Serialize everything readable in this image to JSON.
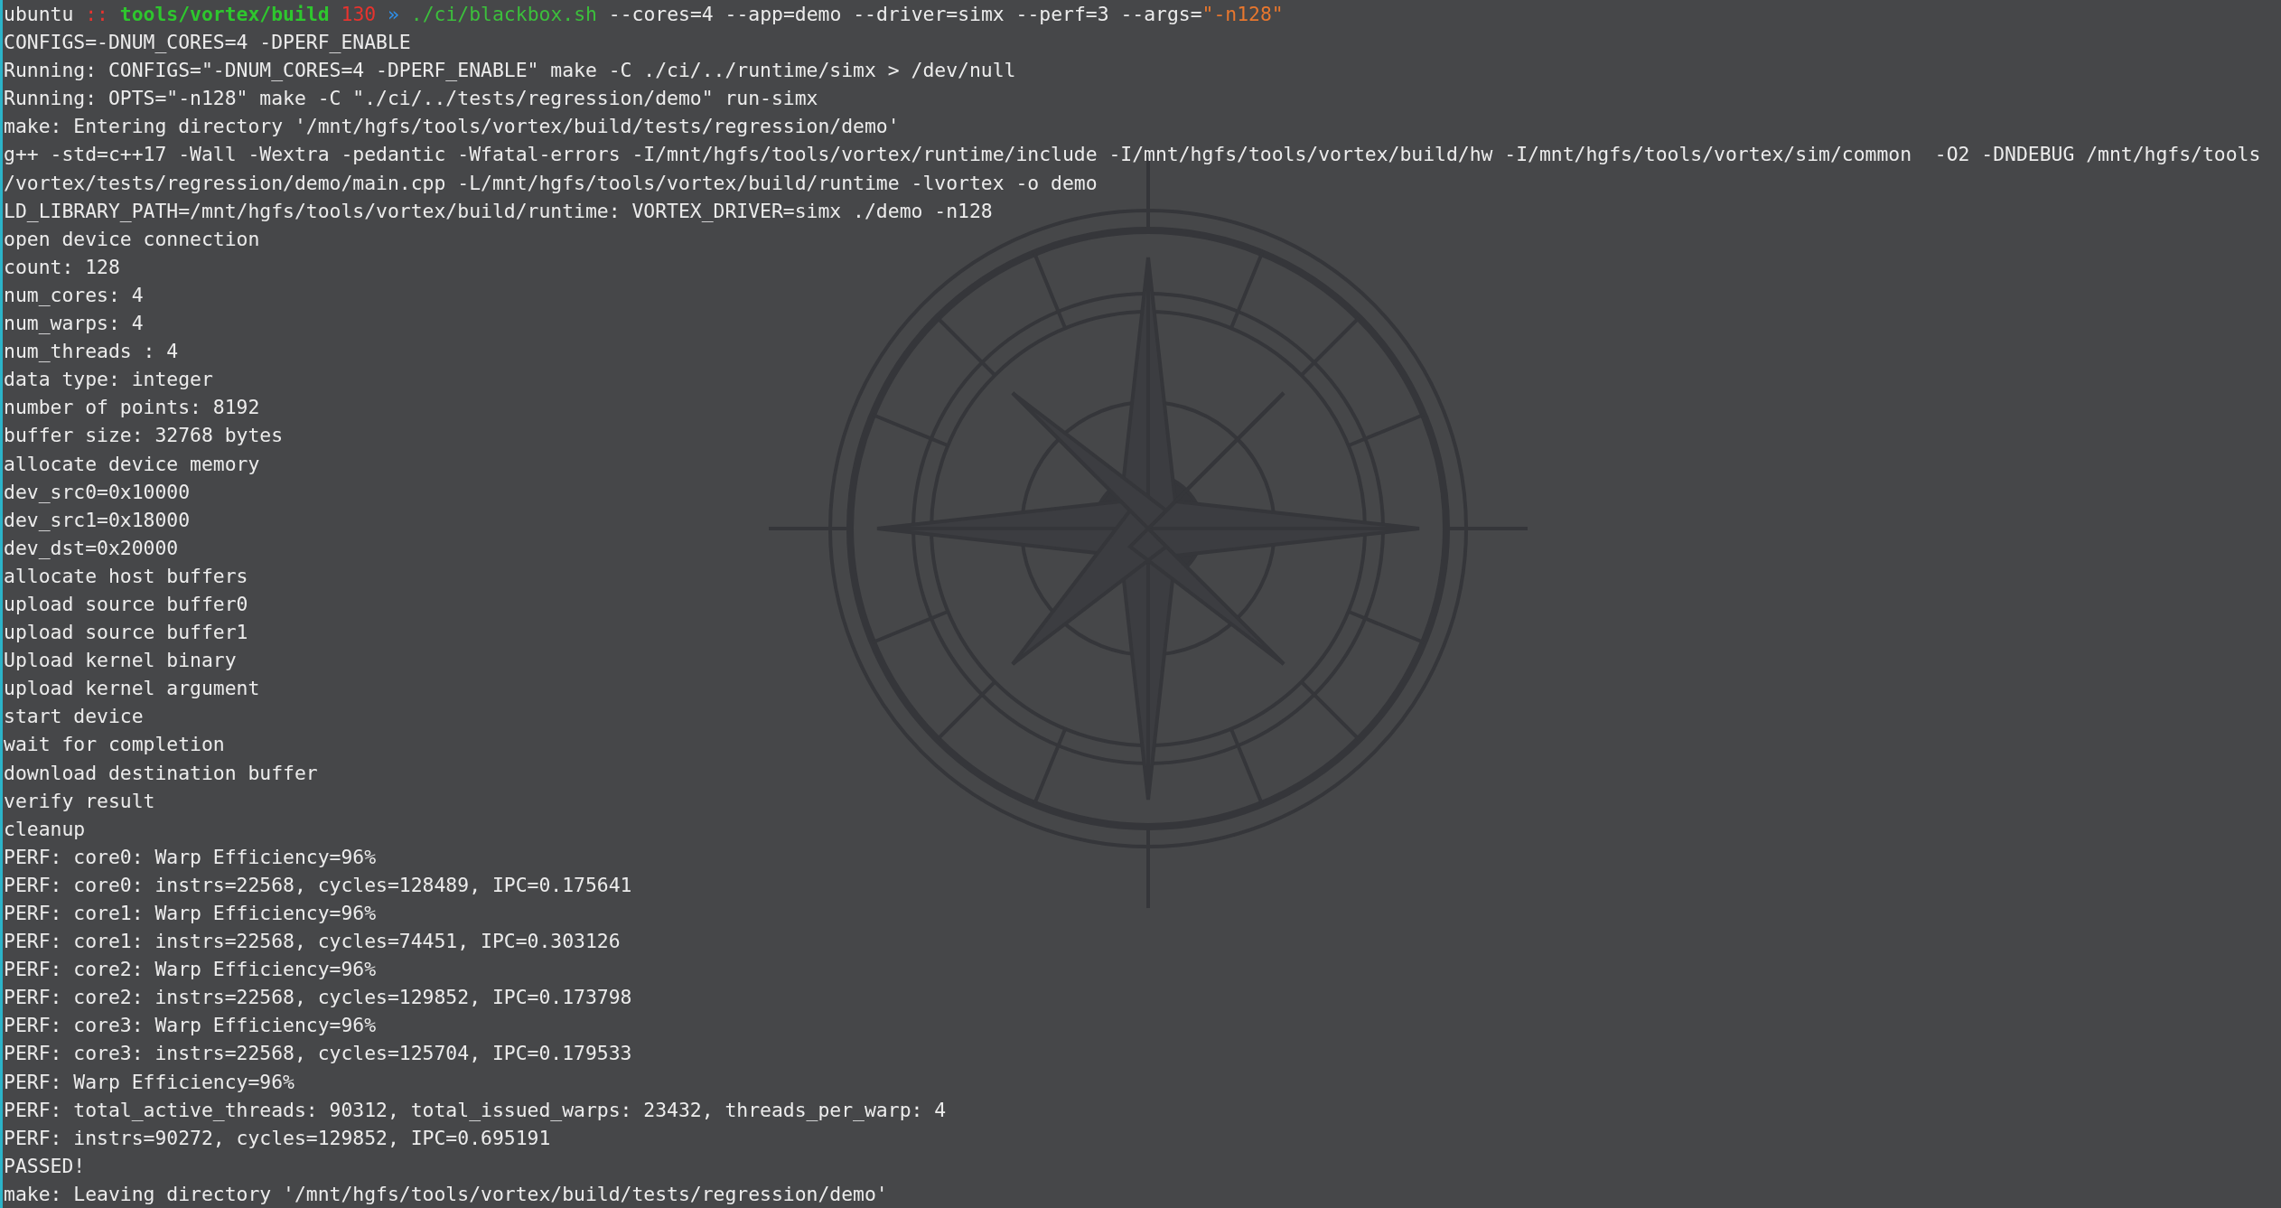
{
  "terminal": {
    "prompt": [
      {
        "kind": "user",
        "text": "ubuntu"
      },
      {
        "kind": "separator",
        "text": "::"
      },
      {
        "kind": "path",
        "text": "tools/vortex/build"
      },
      {
        "kind": "exit-code",
        "text": "130"
      },
      {
        "kind": "arrow",
        "text": "»"
      },
      {
        "kind": "command",
        "text": "./ci/blackbox.sh"
      },
      {
        "kind": "argument",
        "text": "--cores=4 --app=demo --driver=simx --perf=3 --args="
      },
      {
        "kind": "string",
        "text": "\"-n128\""
      }
    ],
    "lines": [
      "CONFIGS=-DNUM_CORES=4 -DPERF_ENABLE",
      "Running: CONFIGS=\"-DNUM_CORES=4 -DPERF_ENABLE\" make -C ./ci/../runtime/simx > /dev/null",
      "Running: OPTS=\"-n128\" make -C \"./ci/../tests/regression/demo\" run-simx",
      "make: Entering directory '/mnt/hgfs/tools/vortex/build/tests/regression/demo'",
      "g++ -std=c++17 -Wall -Wextra -pedantic -Wfatal-errors -I/mnt/hgfs/tools/vortex/runtime/include -I/mnt/hgfs/tools/vortex/build/hw -I/mnt/hgfs/tools/vortex/sim/common  -O2 -DNDEBUG /mnt/hgfs/tools",
      "/vortex/tests/regression/demo/main.cpp -L/mnt/hgfs/tools/vortex/build/runtime -lvortex -o demo",
      "LD_LIBRARY_PATH=/mnt/hgfs/tools/vortex/build/runtime: VORTEX_DRIVER=simx ./demo -n128",
      "open device connection",
      "count: 128",
      "num_cores: 4",
      "num_warps: 4",
      "num_threads : 4",
      "data type: integer",
      "number of points: 8192",
      "buffer size: 32768 bytes",
      "allocate device memory",
      "dev_src0=0x10000",
      "dev_src1=0x18000",
      "dev_dst=0x20000",
      "allocate host buffers",
      "upload source buffer0",
      "upload source buffer1",
      "Upload kernel binary",
      "upload kernel argument",
      "start device",
      "wait for completion",
      "download destination buffer",
      "verify result",
      "cleanup",
      "PERF: core0: Warp Efficiency=96%",
      "PERF: core0: instrs=22568, cycles=128489, IPC=0.175641",
      "PERF: core1: Warp Efficiency=96%",
      "PERF: core1: instrs=22568, cycles=74451, IPC=0.303126",
      "PERF: core2: Warp Efficiency=96%",
      "PERF: core2: instrs=22568, cycles=129852, IPC=0.173798",
      "PERF: core3: Warp Efficiency=96%",
      "PERF: core3: instrs=22568, cycles=125704, IPC=0.179533",
      "PERF: Warp Efficiency=96%",
      "PERF: total_active_threads: 90312, total_issued_warps: 23432, threads_per_warp: 4",
      "PERF: instrs=90272, cycles=129852, IPC=0.695191",
      "PASSED!",
      "make: Leaving directory '/mnt/hgfs/tools/vortex/build/tests/regression/demo'"
    ]
  }
}
